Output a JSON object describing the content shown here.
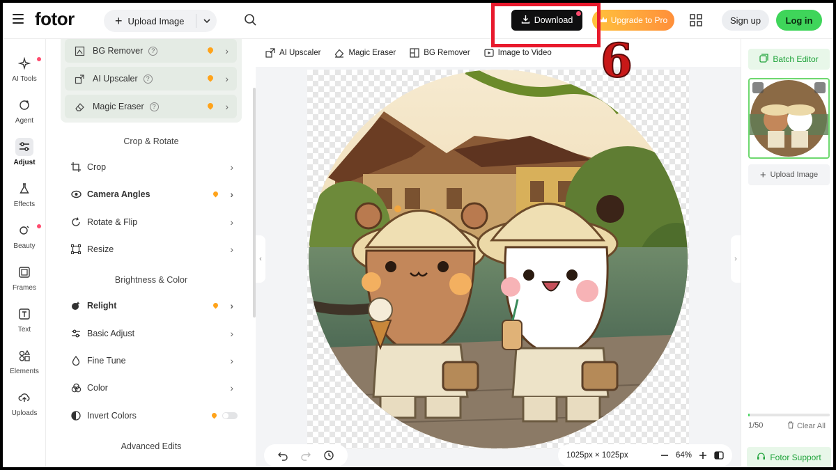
{
  "header": {
    "logo": "fotor",
    "upload_label": "Upload Image",
    "download_label": "Download",
    "upgrade_label": "Upgrade to Pro",
    "signup_label": "Sign up",
    "login_label": "Log in",
    "step_annotation": "6",
    "colors": {
      "download_bg": "#0f0f10",
      "login_bg": "#3fd55a",
      "highlight": "#e8192c",
      "upgrade_from": "#ffc23d",
      "upgrade_to": "#ff8f3a"
    }
  },
  "rail": {
    "items": [
      {
        "label": "AI Tools",
        "icon": "sparkle-icon",
        "has_dot": true
      },
      {
        "label": "Agent",
        "icon": "agent-icon"
      },
      {
        "label": "Adjust",
        "icon": "sliders-icon",
        "active": true
      },
      {
        "label": "Effects",
        "icon": "flask-icon"
      },
      {
        "label": "Beauty",
        "icon": "beauty-icon",
        "has_dot": true
      },
      {
        "label": "Frames",
        "icon": "frame-icon"
      },
      {
        "label": "Text",
        "icon": "text-icon"
      },
      {
        "label": "Elements",
        "icon": "shapes-icon"
      },
      {
        "label": "Uploads",
        "icon": "cloud-upload-icon"
      }
    ]
  },
  "panel": {
    "cards": [
      {
        "label": "BG Remover",
        "icon": "bg-remover-icon"
      },
      {
        "label": "AI Upscaler",
        "icon": "upscaler-icon"
      },
      {
        "label": "Magic Eraser",
        "icon": "eraser-icon"
      }
    ],
    "sections": {
      "crop_rotate": "Crop & Rotate",
      "brightness_color": "Brightness & Color",
      "advanced": "Advanced Edits"
    },
    "crop_items": [
      {
        "label": "Crop",
        "icon": "crop-icon",
        "bold": false,
        "crown": false
      },
      {
        "label": "Camera Angles",
        "icon": "camera-angle-icon",
        "bold": true,
        "crown": true
      },
      {
        "label": "Rotate & Flip",
        "icon": "rotate-icon",
        "bold": false,
        "crown": false
      },
      {
        "label": "Resize",
        "icon": "resize-icon",
        "bold": false,
        "crown": false
      }
    ],
    "color_items": [
      {
        "label": "Relight",
        "icon": "relight-icon",
        "bold": true,
        "crown": true
      },
      {
        "label": "Basic Adjust",
        "icon": "adjust-icon",
        "bold": false,
        "crown": false
      },
      {
        "label": "Fine Tune",
        "icon": "drop-icon",
        "bold": false,
        "crown": false
      },
      {
        "label": "Color",
        "icon": "color-icon",
        "bold": false,
        "crown": false
      },
      {
        "label": "Invert Colors",
        "icon": "invert-icon",
        "bold": false,
        "crown": true,
        "toggle": true
      }
    ]
  },
  "canvas": {
    "toolbar": [
      {
        "label": "AI Upscaler",
        "icon": "upscaler-icon"
      },
      {
        "label": "Magic Eraser",
        "icon": "eraser-icon"
      },
      {
        "label": "BG Remover",
        "icon": "bg-remover-icon"
      },
      {
        "label": "Image to Video",
        "icon": "video-icon"
      }
    ],
    "dimensions": "1025px × 1025px",
    "zoom": "64%"
  },
  "right": {
    "batch_label": "Batch Editor",
    "upload_label": "Upload Image",
    "count": "1/50",
    "count_progress": 0.02,
    "clear_label": "Clear All",
    "support_label": "Fotor Support"
  }
}
